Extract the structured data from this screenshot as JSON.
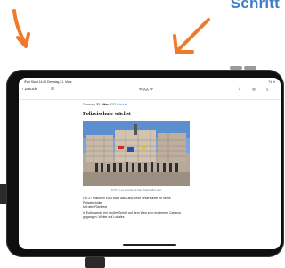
{
  "banner": {
    "title": "Schritt"
  },
  "status_bar": {
    "time_date": "iPad Stadt 14:46 Dienstag 21. März",
    "battery": "74 %"
  },
  "toolbar": {
    "back_label": "Zurück",
    "text_size_label": "AA",
    "icons": [
      "chevron-left-icon",
      "sidebar-icon",
      "minus-icon",
      "text-size-icon",
      "plus-icon",
      "share-icon",
      "safari-icon",
      "bookmark-icon"
    ]
  },
  "article": {
    "date_prefix": "Dienstag,",
    "date_bold": "21. März",
    "year": "2023",
    "site": "Website",
    "headline": "Polizeischule wächst",
    "caption": "FOTO: Leo Roeder/ob Mar Weiker/dPa idpo",
    "body": [
      "Für 27 Millionen Euro baut das Land neue Unterkünfte für seine Polizeischüler.",
      "Mit dem Richtfest",
      "in Eutin werde ein großer Schritt auf dem Weg zum modernen Campus",
      "gegangen. Weiter auf Lokales"
    ]
  },
  "colors": {
    "accent": "#3f7fc9",
    "arrow": "#f07a2c",
    "tablet": "#0f0f10"
  }
}
